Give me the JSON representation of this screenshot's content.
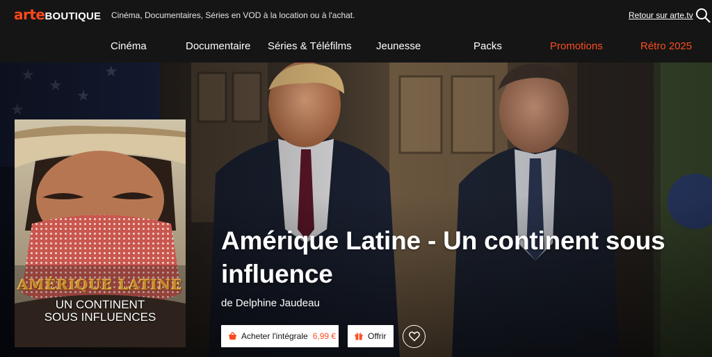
{
  "header": {
    "logo_arte": "arte",
    "logo_boutique": "BOUTIQUE",
    "tagline": "Cinéma, Documentaires, Séries en VOD à la location ou à l'achat.",
    "back_link": "Retour sur arte.tv",
    "search_icon": "search-icon"
  },
  "nav": {
    "items": [
      {
        "label": "Cinéma"
      },
      {
        "label": "Documentaire"
      },
      {
        "label": "Séries & Téléfilms"
      },
      {
        "label": "Jeunesse"
      },
      {
        "label": "Packs"
      },
      {
        "label": "Promotions"
      },
      {
        "label": "Rétro 2025"
      }
    ]
  },
  "hero": {
    "title": "Amérique Latine - Un continent sous influence",
    "director": "de Delphine Jaudeau",
    "poster": {
      "title_line1": "AMÉRIQUE LATINE",
      "title_line2a": "UN CONTINENT",
      "title_line2b": "SOUS INFLUENCES"
    },
    "buy_button": {
      "label": "Acheter l'intégrale",
      "price": "6,99 €",
      "icon": "basket-icon"
    },
    "gift_button": {
      "label": "Offrir",
      "icon": "gift-icon"
    },
    "favorite_button": {
      "icon": "heart-icon"
    }
  },
  "colors": {
    "accent": "#fa481c",
    "promo": "#fa4d1f",
    "background": "#151515"
  }
}
